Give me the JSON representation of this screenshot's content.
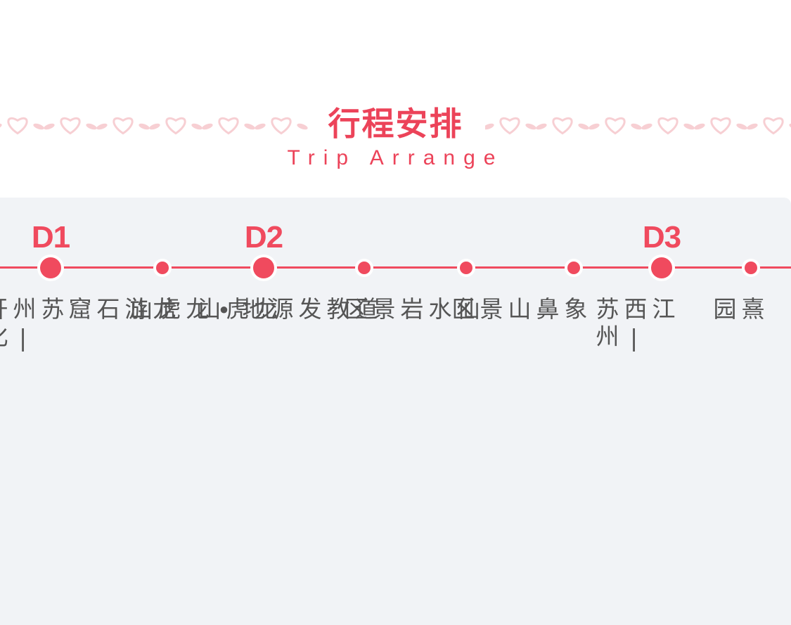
{
  "header": {
    "title": "行程安排",
    "subtitle": "Trip Arrange"
  },
  "colors": {
    "accent": "#f04a5e",
    "heart_ornament": "#f7cfd3",
    "panel_background": "#f1f3f6",
    "label_text": "#555555"
  },
  "timeline": {
    "stops": [
      {
        "day": "D1",
        "label": "苏州|开化"
      },
      {
        "day": "",
        "label": "龙游石窟"
      },
      {
        "day": "D2",
        "label": "龙虎山"
      },
      {
        "day": "",
        "label": "道教发源地•龙虎山"
      },
      {
        "day": "",
        "label": "仙水岩景区"
      },
      {
        "day": "",
        "label": "象鼻山景区"
      },
      {
        "day": "D3",
        "label": "江西|苏州"
      },
      {
        "day": "",
        "label": "熹园"
      }
    ]
  }
}
